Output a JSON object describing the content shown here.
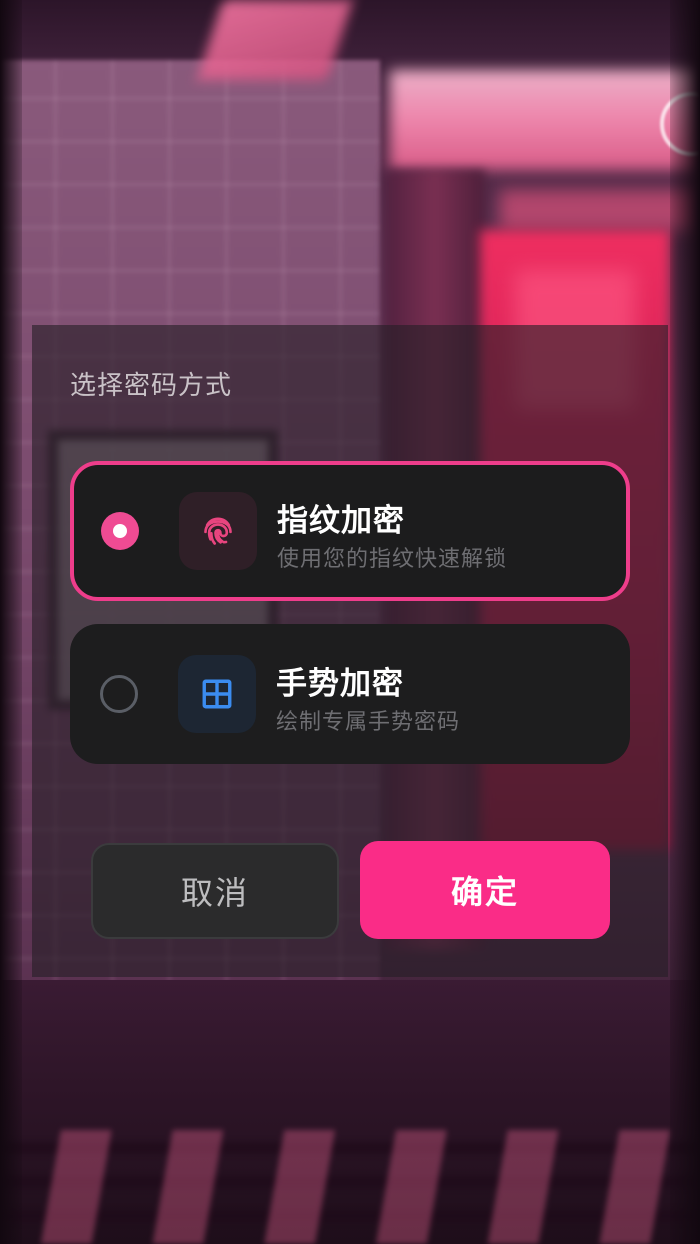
{
  "dialog": {
    "title": "选择密码方式",
    "options": [
      {
        "title": "指纹加密",
        "subtitle": "使用您的指纹快速解锁",
        "icon": "fingerprint-icon",
        "selected": true
      },
      {
        "title": "手势加密",
        "subtitle": "绘制专属手势密码",
        "icon": "grid-icon",
        "selected": false
      }
    ],
    "cancel_label": "取消",
    "confirm_label": "确定"
  },
  "colors": {
    "accent": "#fa2c87",
    "selected_border": "#ee3d8b",
    "card_background": "#1d1d1e",
    "grid_icon": "#3b8cf0"
  }
}
